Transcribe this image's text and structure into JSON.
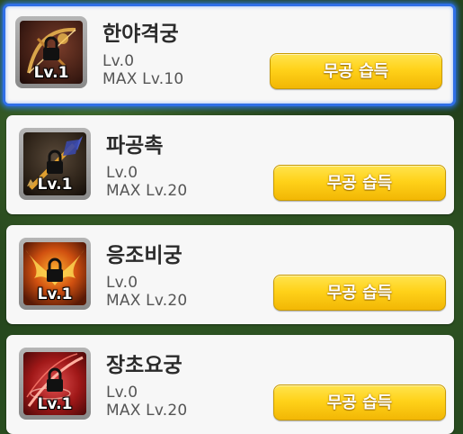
{
  "skills": [
    {
      "name": "한야격궁",
      "level_badge": "Lv.1",
      "current_level": "Lv.0",
      "max_level": "MAX Lv.10",
      "button_label": "무공 습득",
      "selected": true,
      "icon": "bow-dark-icon",
      "theme_color": "#4a2a1e"
    },
    {
      "name": "파공촉",
      "level_badge": "Lv.1",
      "current_level": "Lv.0",
      "max_level": "MAX Lv.20",
      "button_label": "무공 습득",
      "selected": false,
      "icon": "arrowhead-icon",
      "theme_color": "#3a2a1a"
    },
    {
      "name": "응조비궁",
      "level_badge": "Lv.1",
      "current_level": "Lv.0",
      "max_level": "MAX Lv.20",
      "button_label": "무공 습득",
      "selected": false,
      "icon": "flame-wings-icon",
      "theme_color": "#7a2a08"
    },
    {
      "name": "장초요궁",
      "level_badge": "Lv.1",
      "current_level": "Lv.0",
      "max_level": "MAX Lv.20",
      "button_label": "무공 습득",
      "selected": false,
      "icon": "crimson-slash-icon",
      "theme_color": "#8a1a1a"
    }
  ],
  "colors": {
    "button": "#ffd21a",
    "selection_border": "#2f6fe6",
    "card": "#f7f7f7"
  }
}
